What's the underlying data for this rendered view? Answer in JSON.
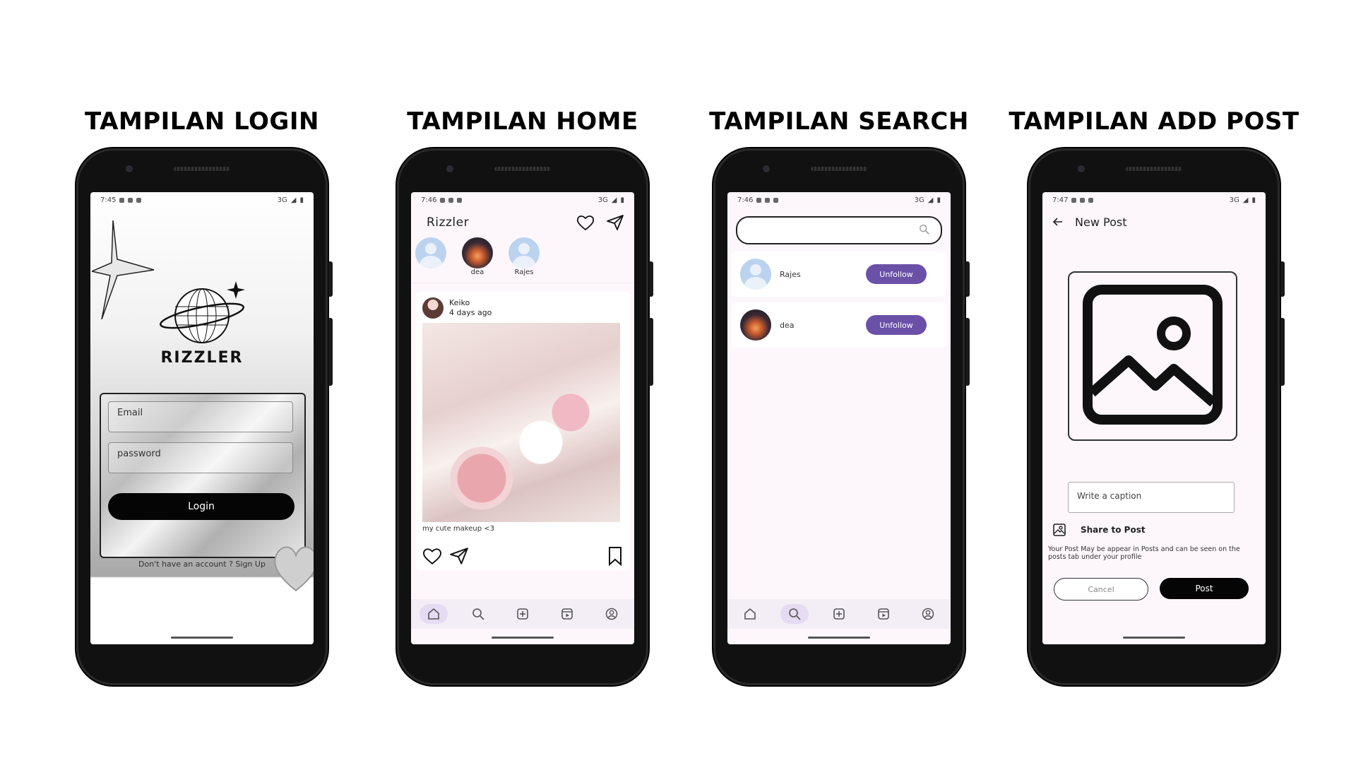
{
  "screens": {
    "login": {
      "heading": "TAMPILAN LOGIN",
      "status": {
        "time": "7:45",
        "network": "3G"
      },
      "brand": "RIZZLER",
      "email_placeholder": "Email",
      "password_placeholder": "password",
      "login_label": "Login",
      "signup_text": "Don't have an account ? Sign Up"
    },
    "home": {
      "heading": "TAMPILAN HOME",
      "status": {
        "time": "7:46",
        "network": "3G"
      },
      "app_title": "Rizzler",
      "stories": [
        {
          "name": ""
        },
        {
          "name": "dea"
        },
        {
          "name": "Rajes"
        }
      ],
      "post": {
        "user": "Keiko",
        "time": "4 days ago",
        "caption": "my cute makeup <3"
      },
      "nav": [
        "home-icon",
        "search-icon",
        "add-icon",
        "reels-icon",
        "profile-icon"
      ]
    },
    "search": {
      "heading": "TAMPILAN SEARCH",
      "status": {
        "time": "7:46",
        "network": "3G"
      },
      "search_value": "",
      "results": [
        {
          "name": "Rajes",
          "action": "Unfollow"
        },
        {
          "name": "dea",
          "action": "Unfollow"
        }
      ]
    },
    "addpost": {
      "heading": "TAMPILAN ADD POST",
      "status": {
        "time": "7:47",
        "network": "3G"
      },
      "title": "New Post",
      "caption_placeholder": "Write a caption",
      "share_label": "Share to Post",
      "share_note": "Your Post May be appear in Posts and can be seen on the posts tab under your profile",
      "cancel_label": "Cancel",
      "post_label": "Post"
    }
  },
  "colors": {
    "accent": "#6b50a8",
    "dark": "#050505",
    "screen_bg": "#fdf7fc"
  }
}
